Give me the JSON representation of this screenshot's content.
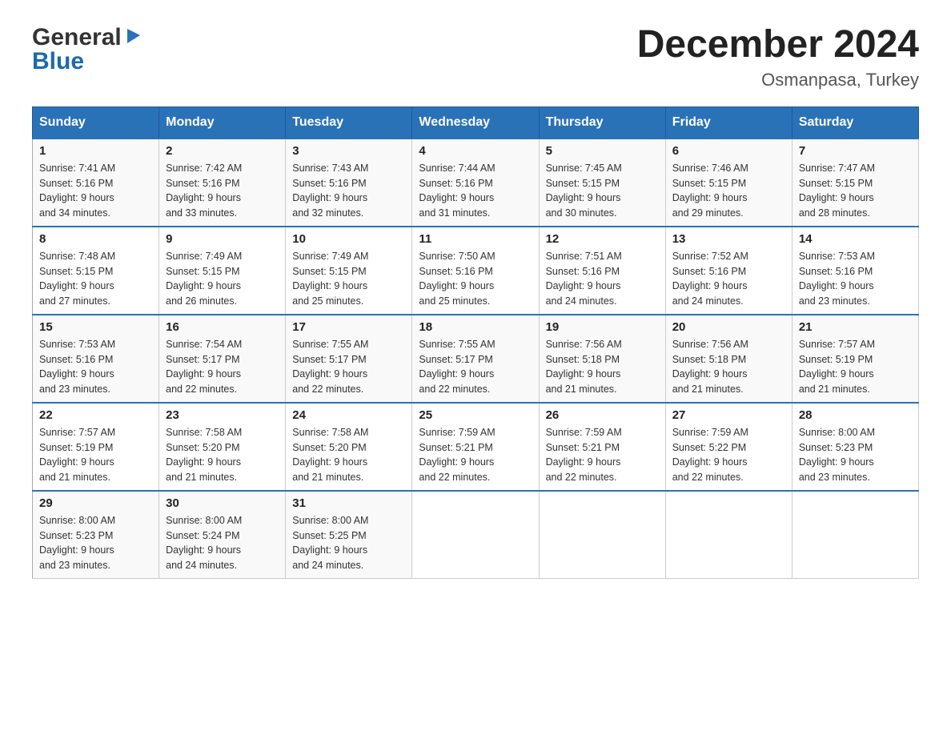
{
  "header": {
    "logo_line1": "General",
    "logo_line2": "Blue",
    "main_title": "December 2024",
    "subtitle": "Osmanpasa, Turkey"
  },
  "days_of_week": [
    "Sunday",
    "Monday",
    "Tuesday",
    "Wednesday",
    "Thursday",
    "Friday",
    "Saturday"
  ],
  "weeks": [
    [
      {
        "day": "1",
        "sunrise": "7:41 AM",
        "sunset": "5:16 PM",
        "daylight": "9 hours and 34 minutes."
      },
      {
        "day": "2",
        "sunrise": "7:42 AM",
        "sunset": "5:16 PM",
        "daylight": "9 hours and 33 minutes."
      },
      {
        "day": "3",
        "sunrise": "7:43 AM",
        "sunset": "5:16 PM",
        "daylight": "9 hours and 32 minutes."
      },
      {
        "day": "4",
        "sunrise": "7:44 AM",
        "sunset": "5:16 PM",
        "daylight": "9 hours and 31 minutes."
      },
      {
        "day": "5",
        "sunrise": "7:45 AM",
        "sunset": "5:15 PM",
        "daylight": "9 hours and 30 minutes."
      },
      {
        "day": "6",
        "sunrise": "7:46 AM",
        "sunset": "5:15 PM",
        "daylight": "9 hours and 29 minutes."
      },
      {
        "day": "7",
        "sunrise": "7:47 AM",
        "sunset": "5:15 PM",
        "daylight": "9 hours and 28 minutes."
      }
    ],
    [
      {
        "day": "8",
        "sunrise": "7:48 AM",
        "sunset": "5:15 PM",
        "daylight": "9 hours and 27 minutes."
      },
      {
        "day": "9",
        "sunrise": "7:49 AM",
        "sunset": "5:15 PM",
        "daylight": "9 hours and 26 minutes."
      },
      {
        "day": "10",
        "sunrise": "7:49 AM",
        "sunset": "5:15 PM",
        "daylight": "9 hours and 25 minutes."
      },
      {
        "day": "11",
        "sunrise": "7:50 AM",
        "sunset": "5:16 PM",
        "daylight": "9 hours and 25 minutes."
      },
      {
        "day": "12",
        "sunrise": "7:51 AM",
        "sunset": "5:16 PM",
        "daylight": "9 hours and 24 minutes."
      },
      {
        "day": "13",
        "sunrise": "7:52 AM",
        "sunset": "5:16 PM",
        "daylight": "9 hours and 24 minutes."
      },
      {
        "day": "14",
        "sunrise": "7:53 AM",
        "sunset": "5:16 PM",
        "daylight": "9 hours and 23 minutes."
      }
    ],
    [
      {
        "day": "15",
        "sunrise": "7:53 AM",
        "sunset": "5:16 PM",
        "daylight": "9 hours and 23 minutes."
      },
      {
        "day": "16",
        "sunrise": "7:54 AM",
        "sunset": "5:17 PM",
        "daylight": "9 hours and 22 minutes."
      },
      {
        "day": "17",
        "sunrise": "7:55 AM",
        "sunset": "5:17 PM",
        "daylight": "9 hours and 22 minutes."
      },
      {
        "day": "18",
        "sunrise": "7:55 AM",
        "sunset": "5:17 PM",
        "daylight": "9 hours and 22 minutes."
      },
      {
        "day": "19",
        "sunrise": "7:56 AM",
        "sunset": "5:18 PM",
        "daylight": "9 hours and 21 minutes."
      },
      {
        "day": "20",
        "sunrise": "7:56 AM",
        "sunset": "5:18 PM",
        "daylight": "9 hours and 21 minutes."
      },
      {
        "day": "21",
        "sunrise": "7:57 AM",
        "sunset": "5:19 PM",
        "daylight": "9 hours and 21 minutes."
      }
    ],
    [
      {
        "day": "22",
        "sunrise": "7:57 AM",
        "sunset": "5:19 PM",
        "daylight": "9 hours and 21 minutes."
      },
      {
        "day": "23",
        "sunrise": "7:58 AM",
        "sunset": "5:20 PM",
        "daylight": "9 hours and 21 minutes."
      },
      {
        "day": "24",
        "sunrise": "7:58 AM",
        "sunset": "5:20 PM",
        "daylight": "9 hours and 21 minutes."
      },
      {
        "day": "25",
        "sunrise": "7:59 AM",
        "sunset": "5:21 PM",
        "daylight": "9 hours and 22 minutes."
      },
      {
        "day": "26",
        "sunrise": "7:59 AM",
        "sunset": "5:21 PM",
        "daylight": "9 hours and 22 minutes."
      },
      {
        "day": "27",
        "sunrise": "7:59 AM",
        "sunset": "5:22 PM",
        "daylight": "9 hours and 22 minutes."
      },
      {
        "day": "28",
        "sunrise": "8:00 AM",
        "sunset": "5:23 PM",
        "daylight": "9 hours and 23 minutes."
      }
    ],
    [
      {
        "day": "29",
        "sunrise": "8:00 AM",
        "sunset": "5:23 PM",
        "daylight": "9 hours and 23 minutes."
      },
      {
        "day": "30",
        "sunrise": "8:00 AM",
        "sunset": "5:24 PM",
        "daylight": "9 hours and 24 minutes."
      },
      {
        "day": "31",
        "sunrise": "8:00 AM",
        "sunset": "5:25 PM",
        "daylight": "9 hours and 24 minutes."
      },
      null,
      null,
      null,
      null
    ]
  ],
  "labels": {
    "sunrise": "Sunrise:",
    "sunset": "Sunset:",
    "daylight": "Daylight:"
  }
}
